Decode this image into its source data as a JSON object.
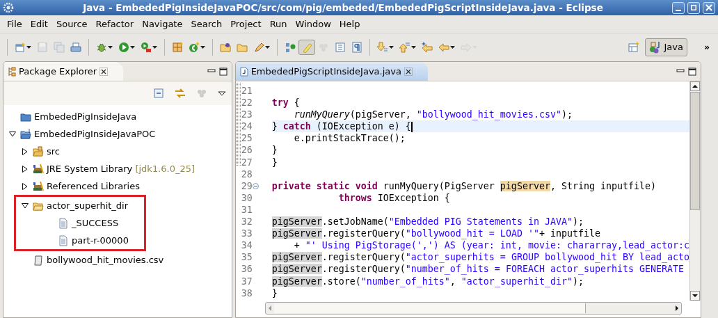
{
  "window": {
    "title": "Java - EmbededPigInsideJavaPOC/src/com/pig/embeded/EmbededPigScriptInsideJava.java - Eclipse"
  },
  "menu": [
    "File",
    "Edit",
    "Source",
    "Refactor",
    "Navigate",
    "Search",
    "Project",
    "Run",
    "Window",
    "Help"
  ],
  "toolbar": {
    "groups": [
      [
        {
          "dropdown": true,
          "disabled": false,
          "pressed": false
        },
        {
          "dropdown": false,
          "disabled": true,
          "pressed": false
        },
        {
          "dropdown": false,
          "disabled": true,
          "pressed": false
        },
        {
          "dropdown": false,
          "disabled": false,
          "pressed": false
        }
      ],
      [
        {
          "dropdown": true,
          "disabled": false,
          "pressed": false
        },
        {
          "dropdown": true,
          "disabled": false,
          "pressed": false
        },
        {
          "dropdown": true,
          "disabled": false,
          "pressed": false
        }
      ],
      [
        {
          "dropdown": false,
          "disabled": false,
          "pressed": false
        },
        {
          "dropdown": true,
          "disabled": false,
          "pressed": false
        }
      ],
      [
        {
          "dropdown": false,
          "disabled": false,
          "pressed": false
        },
        {
          "dropdown": false,
          "disabled": false,
          "pressed": false
        },
        {
          "dropdown": true,
          "disabled": false,
          "pressed": false
        }
      ],
      [
        {
          "dropdown": false,
          "disabled": false,
          "pressed": false
        },
        {
          "dropdown": false,
          "disabled": false,
          "pressed": true
        },
        {
          "dropdown": false,
          "disabled": true,
          "pressed": false
        },
        {
          "dropdown": false,
          "disabled": false,
          "pressed": false
        },
        {
          "dropdown": false,
          "disabled": false,
          "pressed": false
        }
      ],
      [
        {
          "dropdown": true,
          "disabled": false,
          "pressed": false
        },
        {
          "dropdown": true,
          "disabled": false,
          "pressed": false
        },
        {
          "dropdown": false,
          "disabled": false,
          "pressed": false
        },
        {
          "dropdown": true,
          "disabled": false,
          "pressed": false
        },
        {
          "dropdown": true,
          "disabled": true,
          "pressed": false
        }
      ]
    ],
    "perspective": {
      "label": "Java",
      "selected": true
    },
    "overflow": "»"
  },
  "explorer": {
    "tab": {
      "label": "Package Explorer",
      "selected": true
    },
    "tree": [
      {
        "label": "EmbededPigInsideJava",
        "kind": "project"
      },
      {
        "label": "EmbededPigInsideJavaPOC",
        "kind": "open-project",
        "expanded": true,
        "children": [
          {
            "label": "src",
            "kind": "source-folder",
            "expanded": false
          },
          {
            "label": "JRE System Library",
            "suffix": "[jdk1.6.0_25]",
            "kind": "library",
            "expanded": false
          },
          {
            "label": "Referenced Libraries",
            "kind": "library",
            "expanded": false
          },
          {
            "label": "actor_superhit_dir",
            "kind": "folder",
            "expanded": true,
            "highlighted": true,
            "children": [
              {
                "label": "_SUCCESS",
                "kind": "file"
              },
              {
                "label": "part-r-00000",
                "kind": "file"
              }
            ]
          },
          {
            "label": "bollywood_hit_movies.csv",
            "kind": "csv"
          }
        ]
      }
    ]
  },
  "editor": {
    "tab": {
      "label": "EmbededPigScriptInsideJava.java",
      "selected": true
    },
    "lines": [
      {
        "number": "21",
        "current": false,
        "fold": false
      },
      {
        "number": "22",
        "current": false,
        "fold": false,
        "tokens": [
          {
            "kind": "keyword",
            "t": "try"
          },
          {
            "kind": "plain",
            "t": " {"
          }
        ]
      },
      {
        "number": "23",
        "current": false,
        "fold": false,
        "tokens": [
          {
            "kind": "static-call",
            "t": "    runMyQuery"
          },
          {
            "kind": "plain",
            "t": "(pigServer, "
          },
          {
            "kind": "string",
            "t": "\"bollywood_hit_movies.csv\""
          },
          {
            "kind": "plain",
            "t": ");"
          }
        ]
      },
      {
        "number": "24",
        "current": true,
        "fold": false,
        "tokens": [
          {
            "kind": "plain",
            "t": "} "
          },
          {
            "kind": "keyword",
            "t": "catch"
          },
          {
            "kind": "plain",
            "t": " (IOException e) {"
          }
        ]
      },
      {
        "number": "25",
        "current": false,
        "fold": false,
        "tokens": [
          {
            "kind": "plain",
            "t": "    e.printStackTrace();"
          }
        ]
      },
      {
        "number": "26",
        "current": false,
        "fold": false,
        "tokens": [
          {
            "kind": "plain",
            "t": "}"
          }
        ]
      },
      {
        "number": "27",
        "current": false,
        "fold": false,
        "tokens": [
          {
            "kind": "plain",
            "t": "}"
          }
        ]
      },
      {
        "number": "28",
        "current": false,
        "fold": false
      },
      {
        "number": "29",
        "current": false,
        "fold": true,
        "tokens": [
          {
            "kind": "keyword",
            "t": "private static void"
          },
          {
            "kind": "plain",
            "t": " runMyQuery(PigServer "
          },
          {
            "kind": "declaration",
            "t": "pigServer"
          },
          {
            "kind": "plain",
            "t": ", String inputfile)"
          }
        ]
      },
      {
        "number": "30",
        "current": false,
        "fold": false,
        "tokens": [
          {
            "kind": "keyword",
            "t": "            throws"
          },
          {
            "kind": "plain",
            "t": " IOException {"
          }
        ]
      },
      {
        "number": "31",
        "current": false,
        "fold": false
      },
      {
        "number": "32",
        "current": false,
        "fold": false,
        "tokens": [
          {
            "kind": "occurrence",
            "t": "pigServer"
          },
          {
            "kind": "plain",
            "t": ".setJobName("
          },
          {
            "kind": "string",
            "t": "\"Embedded PIG Statements in JAVA\""
          },
          {
            "kind": "plain",
            "t": ");"
          }
        ]
      },
      {
        "number": "33",
        "current": false,
        "fold": false,
        "tokens": [
          {
            "kind": "occurrence",
            "t": "pigServer"
          },
          {
            "kind": "plain",
            "t": ".registerQuery("
          },
          {
            "kind": "string",
            "t": "\"bollywood_hit = LOAD '\""
          },
          {
            "kind": "plain",
            "t": "+ inputfile"
          }
        ]
      },
      {
        "number": "34",
        "current": false,
        "fold": false,
        "tokens": [
          {
            "kind": "plain",
            "t": "    + "
          },
          {
            "kind": "string",
            "t": "\"' Using PigStorage(',') AS (year: int, movie: chararray,lead_actor:c"
          }
        ]
      },
      {
        "number": "35",
        "current": false,
        "fold": false,
        "tokens": [
          {
            "kind": "occurrence",
            "t": "pigServer"
          },
          {
            "kind": "plain",
            "t": ".registerQuery("
          },
          {
            "kind": "string",
            "t": "\"actor_superhits = GROUP bollywood_hit BY lead_acto"
          }
        ]
      },
      {
        "number": "36",
        "current": false,
        "fold": false,
        "tokens": [
          {
            "kind": "occurrence",
            "t": "pigServer"
          },
          {
            "kind": "plain",
            "t": ".registerQuery("
          },
          {
            "kind": "string",
            "t": "\"number_of_hits = FOREACH actor_superhits GENERATE"
          }
        ]
      },
      {
        "number": "37",
        "current": false,
        "fold": false,
        "tokens": [
          {
            "kind": "occurrence",
            "t": "pigServer"
          },
          {
            "kind": "plain",
            "t": ".store("
          },
          {
            "kind": "string",
            "t": "\"number_of_hits\""
          },
          {
            "kind": "plain",
            "t": ", "
          },
          {
            "kind": "string",
            "t": "\"actor_superhit_dir\""
          },
          {
            "kind": "plain",
            "t": ");"
          }
        ]
      },
      {
        "number": "38",
        "current": false,
        "fold": false,
        "tokens": [
          {
            "kind": "plain",
            "t": "}"
          }
        ]
      }
    ]
  }
}
